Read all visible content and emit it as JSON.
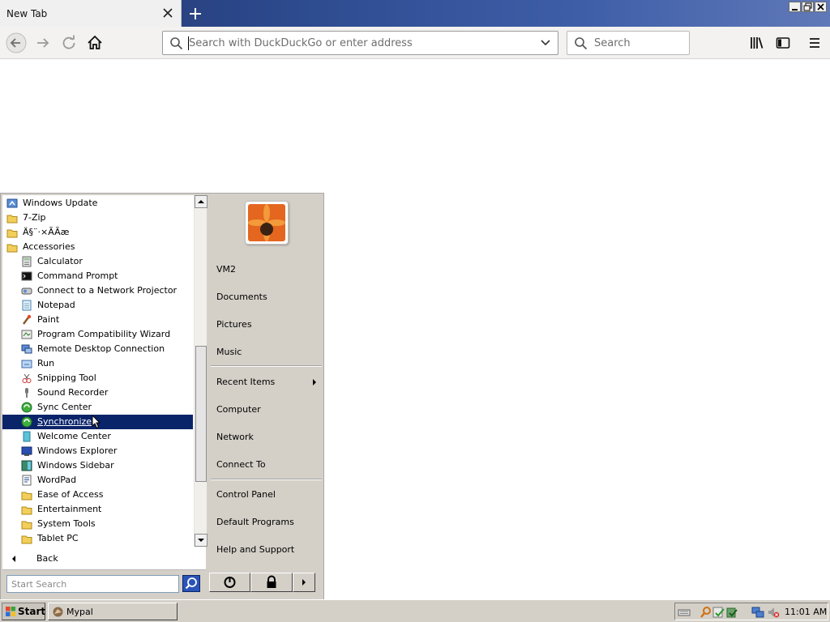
{
  "browser": {
    "tab_title": "New Tab",
    "url_placeholder": "Search with DuckDuckGo or enter address",
    "search_placeholder": "Search",
    "accent_colors": {
      "titlebar": "#2d4a8e",
      "selection": "#0a246a"
    }
  },
  "start_menu": {
    "programs": [
      {
        "label": "Windows Update",
        "icon": "windows-update-icon",
        "indent": 0
      },
      {
        "label": "7-Zip",
        "icon": "folder-icon",
        "indent": 0
      },
      {
        "label": "Ä§¨·×ÃÃæ",
        "icon": "folder-icon",
        "indent": 0
      },
      {
        "label": "Accessories",
        "icon": "folder-icon",
        "indent": 0
      },
      {
        "label": "Calculator",
        "icon": "calculator-icon",
        "indent": 1
      },
      {
        "label": "Command Prompt",
        "icon": "command-prompt-icon",
        "indent": 1
      },
      {
        "label": "Connect to a Network Projector",
        "icon": "projector-icon",
        "indent": 1
      },
      {
        "label": "Notepad",
        "icon": "notepad-icon",
        "indent": 1
      },
      {
        "label": "Paint",
        "icon": "paint-icon",
        "indent": 1
      },
      {
        "label": "Program Compatibility Wizard",
        "icon": "compatibility-wizard-icon",
        "indent": 1
      },
      {
        "label": "Remote Desktop Connection",
        "icon": "remote-desktop-icon",
        "indent": 1
      },
      {
        "label": "Run",
        "icon": "run-icon",
        "indent": 1
      },
      {
        "label": "Snipping Tool",
        "icon": "snipping-tool-icon",
        "indent": 1
      },
      {
        "label": "Sound Recorder",
        "icon": "microphone-icon",
        "indent": 1
      },
      {
        "label": "Sync Center",
        "icon": "sync-center-icon",
        "indent": 1
      },
      {
        "label": "Synchronize",
        "icon": "synchronize-icon",
        "indent": 1,
        "selected": true
      },
      {
        "label": "Welcome Center",
        "icon": "welcome-center-icon",
        "indent": 1
      },
      {
        "label": "Windows Explorer",
        "icon": "windows-explorer-icon",
        "indent": 1
      },
      {
        "label": "Windows Sidebar",
        "icon": "windows-sidebar-icon",
        "indent": 1
      },
      {
        "label": "WordPad",
        "icon": "wordpad-icon",
        "indent": 1
      },
      {
        "label": "Ease of Access",
        "icon": "folder-icon",
        "indent": 1
      },
      {
        "label": "Entertainment",
        "icon": "folder-icon",
        "indent": 1
      },
      {
        "label": "System Tools",
        "icon": "folder-icon",
        "indent": 1
      },
      {
        "label": "Tablet PC",
        "icon": "folder-icon",
        "indent": 1
      }
    ],
    "back_label": "Back",
    "search_placeholder": "Start Search",
    "right_items": {
      "user": "VM2",
      "documents": "Documents",
      "pictures": "Pictures",
      "music": "Music",
      "recent_items": "Recent Items",
      "computer": "Computer",
      "network": "Network",
      "connect_to": "Connect To",
      "control_panel": "Control Panel",
      "default_programs": "Default Programs",
      "help_and_support": "Help and Support"
    }
  },
  "taskbar": {
    "start_label": "Start",
    "task_label": "Mypal",
    "clock": "11:01 AM"
  }
}
